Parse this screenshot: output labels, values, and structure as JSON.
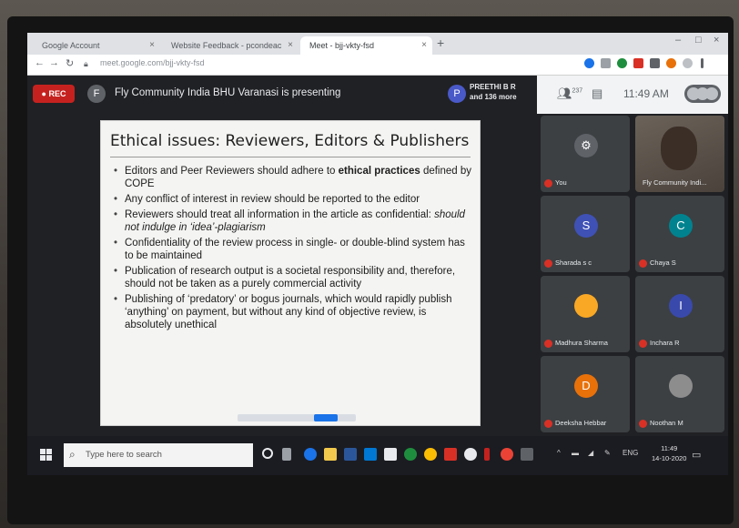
{
  "browser": {
    "tabs": [
      {
        "label": "Google Account",
        "close": "×"
      },
      {
        "label": "Website Feedback - pcondeac",
        "close": "×"
      },
      {
        "label": "Meet - bjj-vkty-fsd",
        "close": "×"
      }
    ],
    "new_tab": "+",
    "url": "meet.google.com/bjj-vkty-fsd",
    "window_controls": [
      "–",
      "□",
      "×"
    ]
  },
  "meet": {
    "rec_label": "● REC",
    "presenter_initial": "F",
    "presenting_text": "Fly Community India BHU Varanasi is presenting",
    "participant_initial": "P",
    "participant_name_line1": "PREETHI B R",
    "participant_name_line2": "and 136 more",
    "people_count": "237",
    "time": "11:49 AM"
  },
  "slide": {
    "title": "Ethical issues: Reviewers, Editors & Publishers",
    "bullets": [
      {
        "pre": "Editors and Peer Reviewers should adhere to ",
        "bold": "ethical practices",
        "post": " defined by COPE"
      },
      {
        "pre": "Any conflict of interest in review should be reported to the editor",
        "bold": "",
        "post": ""
      },
      {
        "pre": "Reviewers should treat all information in the article as confidential: ",
        "bold": "",
        "post": "",
        "italic": "should not indulge in ‘idea’-plagiarism"
      },
      {
        "pre": "Confidentiality of the review process in single- or double-blind system has to be maintained",
        "bold": "",
        "post": ""
      },
      {
        "pre": "Publication of research output is a societal responsibility and, therefore, should not be taken as a purely commercial activity",
        "bold": "",
        "post": ""
      },
      {
        "pre": "Publishing of ‘predatory’ or bogus journals, which would rapidly publish ‘anything’ on payment, but without any kind of objective review, is absolutely unethical",
        "bold": "",
        "post": ""
      }
    ]
  },
  "participants": [
    {
      "name": "You",
      "initial": "",
      "color": "#5f6368"
    },
    {
      "name": "Fly Community Indi...",
      "initial": "",
      "color": ""
    },
    {
      "name": "Sharada s c",
      "initial": "S",
      "color": "#3f51b5"
    },
    {
      "name": "Chaya S",
      "initial": "C",
      "color": "#00838f"
    },
    {
      "name": "Madhura Sharma",
      "initial": "",
      "color": "#f9a825"
    },
    {
      "name": "Inchara R",
      "initial": "I",
      "color": "#3949ab"
    },
    {
      "name": "Deeksha Hebbar",
      "initial": "D",
      "color": "#e8710a"
    },
    {
      "name": "Noothan M",
      "initial": "",
      "color": "#8d8d8d"
    }
  ],
  "taskbar": {
    "search_placeholder": "Type here to search",
    "clock_time": "11:49",
    "clock_date": "14-10-2020",
    "lang": "ENG"
  }
}
